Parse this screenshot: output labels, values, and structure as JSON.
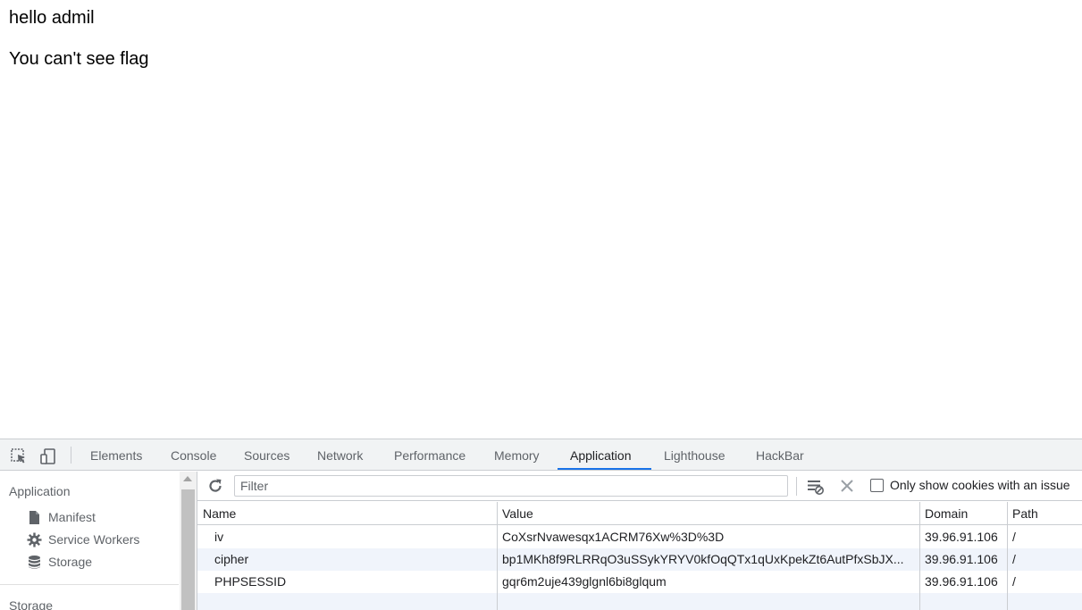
{
  "page": {
    "line1": "hello admil",
    "line2": "You can't see flag"
  },
  "devtools": {
    "tabs": [
      "Elements",
      "Console",
      "Sources",
      "Network",
      "Performance",
      "Memory",
      "Application",
      "Lighthouse",
      "HackBar"
    ],
    "active_tab": "Application",
    "accent_color": "#1a73e8"
  },
  "sidebar": {
    "section_application": "Application",
    "items": [
      {
        "label": "Manifest",
        "icon": "document-icon"
      },
      {
        "label": "Service Workers",
        "icon": "gear-icon"
      },
      {
        "label": "Storage",
        "icon": "database-icon"
      }
    ],
    "section_storage": "Storage"
  },
  "toolbar": {
    "filter_placeholder": "Filter",
    "filter_value": "",
    "only_issue_label": "Only show cookies with an issue",
    "only_issue_checked": false
  },
  "cookies": {
    "columns": [
      "Name",
      "Value",
      "Domain",
      "Path"
    ],
    "rows": [
      {
        "name": "iv",
        "value": "CoXsrNvawesqx1ACRM76Xw%3D%3D",
        "domain": "39.96.91.106",
        "path": "/"
      },
      {
        "name": "cipher",
        "value": "bp1MKh8f9RLRRqO3uSSykYRYV0kfOqQTx1qUxKpekZt6AutPfxSbJX...",
        "domain": "39.96.91.106",
        "path": "/"
      },
      {
        "name": "PHPSESSID",
        "value": "gqr6m2uje439glgnl6bi8glqum",
        "domain": "39.96.91.106",
        "path": "/"
      }
    ]
  }
}
